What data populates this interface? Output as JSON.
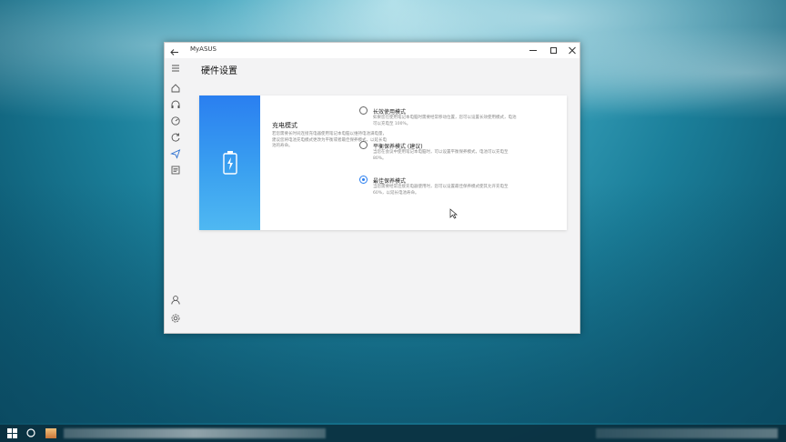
{
  "window": {
    "app_title": "MyASUS"
  },
  "header": {
    "page_title": "硬件设置"
  },
  "charging": {
    "section_title": "充电模式",
    "section_desc": "若您需要长时间连接充电器使用笔记本电脑以维持电池满电量，建议您将电池充电模式更改为平衡或者最佳保养模式，以延长电池的寿命。",
    "options": [
      {
        "label": "长效使用模式",
        "desc": "如果您在使用笔记本电脑时需要经常移动位置，您可以设置长效使用模式，电池可以充电至 100%。",
        "selected": false
      },
      {
        "label": "平衡保养模式 (建议)",
        "desc": "当您在会议中使用笔记本电脑时，可以设置平衡保养模式，电池可以充电至 80%。",
        "selected": false
      },
      {
        "label": "最佳保养模式",
        "desc": "当您需要经常连接充电器使用时，您可以设置最佳保养模式使其允许充电至 60%，以延长电池寿命。",
        "selected": true
      }
    ]
  },
  "colors": {
    "accent": "#2a7ff0",
    "banner_top": "#2a7ff0",
    "banner_bottom": "#4fb8f2"
  },
  "icons": {
    "sidebar": [
      "menu-icon",
      "home-icon",
      "headset-icon",
      "dashboard-icon",
      "refresh-icon",
      "send-icon",
      "article-icon",
      "user-icon",
      "settings-icon"
    ],
    "banner": "battery-charging-icon"
  }
}
